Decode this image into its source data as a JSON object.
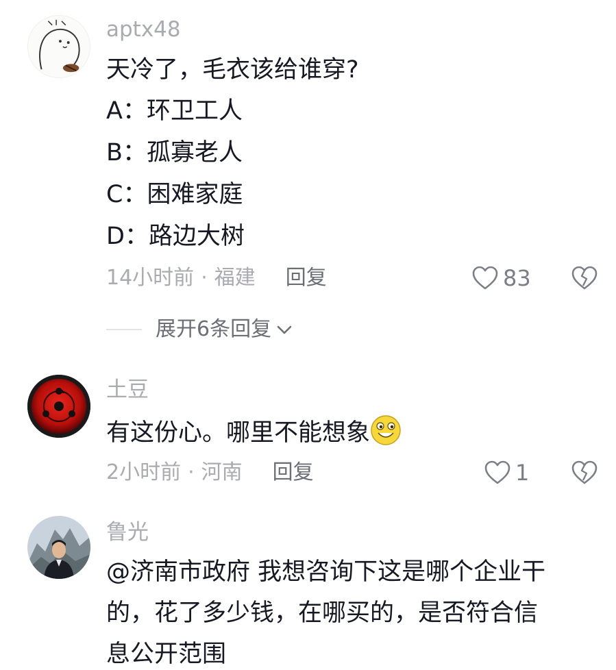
{
  "comments": [
    {
      "username": "aptx48",
      "lines": [
        "天冷了，毛衣该给谁穿?",
        "A：环卫工人",
        "B：孤寡老人",
        "C：困难家庭",
        "D：路边大树"
      ],
      "time": "14小时前",
      "location": "福建",
      "reply_label": "回复",
      "likes": "83",
      "expand_label": "展开6条回复"
    },
    {
      "username": "土豆",
      "lines": [
        "有这份心。哪里不能想象"
      ],
      "time": "2小时前",
      "location": "河南",
      "reply_label": "回复",
      "likes": "1"
    },
    {
      "username": "鲁光",
      "lines": [
        "@济南市政府 我想咨询下这是哪个企业干",
        "的，花了多少钱，在哪买的，是否符合信",
        "息公开范围"
      ]
    }
  ],
  "meta_separator": "·",
  "icons": {
    "like": "heart-outline-icon",
    "dislike": "broken-heart-icon",
    "expand": "chevron-down-icon",
    "emoji": "grinning-face-emoji"
  },
  "colors": {
    "primary_text": "#161823",
    "secondary_text": "#a9abb0",
    "reply_text": "#6b6e75"
  }
}
